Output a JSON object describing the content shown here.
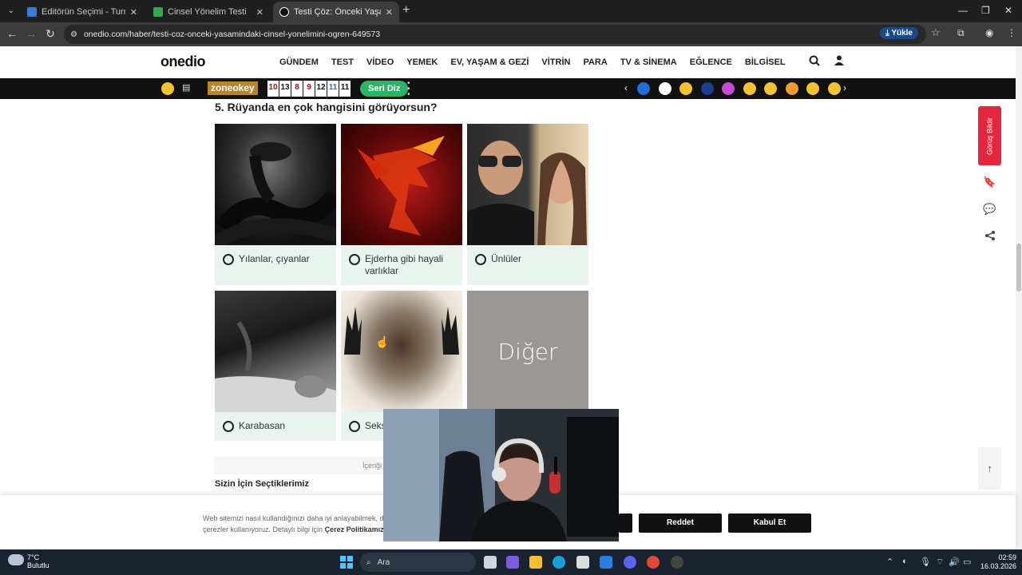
{
  "browser": {
    "tabs": [
      {
        "title": "Editörün Seçimi - Turnuva - Qu"
      },
      {
        "title": "Cinsel Yönelim Testi"
      },
      {
        "title": "Testi Çöz: Önceki Yaşamındaki C"
      }
    ],
    "url": "onedio.com/haber/testi-coz-onceki-yasamindaki-cinsel-yonelimini-ogren-649573",
    "update_label": "Yükle"
  },
  "site": {
    "logo": "onedio",
    "menu": [
      "GÜNDEM",
      "TEST",
      "VİDEO",
      "YEMEK",
      "EV, YAŞAM & GEZİ",
      "VİTRİN",
      "PARA",
      "TV & SİNEMA",
      "EĞLENCE",
      "BİLGİSEL"
    ],
    "zone": "zoneokey",
    "numbers": [
      "10",
      "13",
      "8",
      "9",
      "12",
      "11",
      "11"
    ],
    "seri_label": "Seri Diz",
    "badge_colors": [
      "#1e6fd9",
      "#ffffff",
      "#f2c230",
      "#1d3d8f",
      "#c84bd6",
      "#f2c230",
      "#f2c230",
      "#f29b30",
      "#f2c230",
      "#f2c230"
    ]
  },
  "quiz": {
    "question": "5. Rüyanda en çok hangisini görüyorsun?",
    "options": [
      {
        "label": "Yılanlar, çıyanlar",
        "image": "snake"
      },
      {
        "label": "Ejderha gibi hayali varlıklar",
        "image": "dragon"
      },
      {
        "label": "Ünlüler",
        "image": "celebrities"
      },
      {
        "label": "Karabasan",
        "image": "sleeping-person"
      },
      {
        "label": "Seks",
        "image": "blurred-figure"
      },
      {
        "label": "Diğer",
        "image": "other-gray"
      }
    ],
    "other_image_text": "Diğer"
  },
  "side": {
    "feedback": "Görüş Bildir"
  },
  "below": {
    "content_text": "İçeriği",
    "picks_title": "Sizin İçin Seçtiklerimiz"
  },
  "cookie": {
    "text_line1": "Web sitemizi nasıl kullandığınızı daha iyi anlayabilmek, der",
    "text_line2_prefix": "çerezler kullanıyoruz. Detaylı bilgi için ",
    "policy_link": "Çerez Politikamızı",
    "reject": "Reddet",
    "accept": "Kabul Et"
  },
  "taskbar": {
    "temp": "7°C",
    "weather": "Bulutlu",
    "search": "Ara",
    "time": "02:59",
    "date": "16.03.2026"
  }
}
